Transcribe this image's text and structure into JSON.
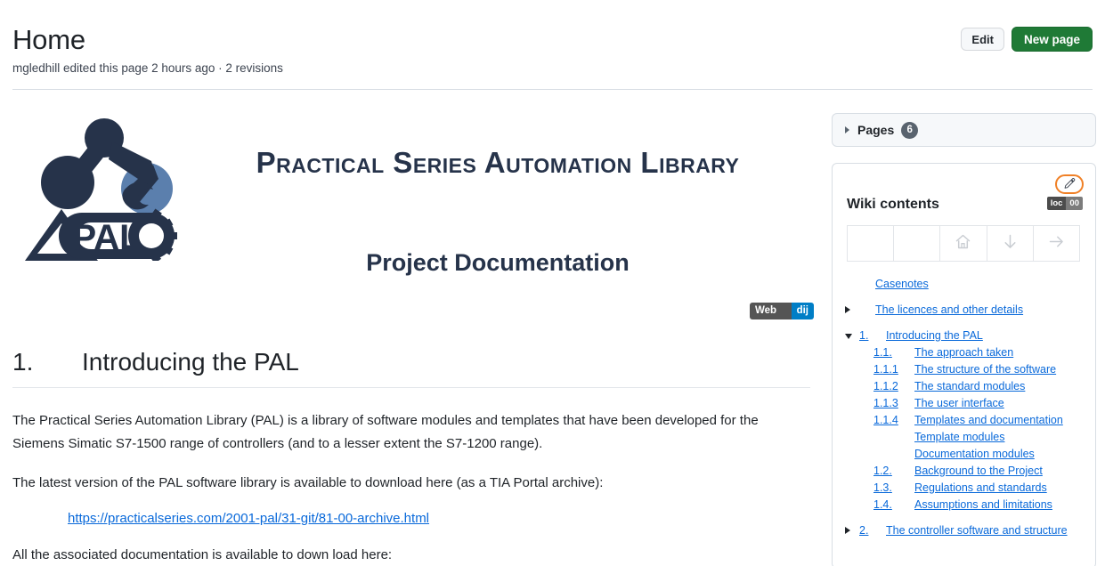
{
  "header": {
    "title": "Home",
    "subtitle": "mgledhill edited this page 2 hours ago · 2 revisions",
    "edit_label": "Edit",
    "new_page_label": "New page"
  },
  "banner": {
    "title": "Practical Series Automation Library",
    "subtitle": "Project Documentation",
    "logo_text": "PAL",
    "logo_colors": {
      "dark": "#26334a",
      "blue": "#5b7fad"
    },
    "webid_badge": {
      "left": "Web ID",
      "right": "dij",
      "left_color": "#555555",
      "right_color": "#007ec6"
    }
  },
  "content": {
    "heading_number": "1.",
    "heading_text": "Introducing the PAL",
    "paragraph_1": "The Practical Series Automation Library (PAL) is a library of software modules and templates that have been developed for the Siemens Simatic S7-1500 range of controllers (and to a lesser extent the S7-1200 range).",
    "paragraph_2": "The latest version of the PAL software library is available to download here (as a TIA Portal archive):",
    "download_link": "https://practicalseries.com/2001-pal/31-git/81-00-archive.html",
    "paragraph_3": "All the associated documentation is available to down load here:"
  },
  "sidebar": {
    "pages": {
      "label": "Pages",
      "count": "6"
    },
    "wiki_contents_title": "Wiki contents",
    "edit_icon": "pencil-icon",
    "loc_badge": {
      "left": "loc",
      "right": "00",
      "left_color": "#4c4c4c",
      "right_color": "#7c7c7c"
    },
    "nav_table": [
      {
        "icon": "",
        "name": "nav-cell-empty-1"
      },
      {
        "icon": "",
        "name": "nav-cell-empty-2"
      },
      {
        "icon": "home-icon",
        "name": "nav-cell-home"
      },
      {
        "icon": "arrow-down-icon",
        "name": "nav-cell-down"
      },
      {
        "icon": "arrow-right-icon",
        "name": "nav-cell-forward"
      }
    ],
    "toc": [
      {
        "caret": "none",
        "num": "",
        "label": "Casenotes",
        "indent": 1,
        "gap": false
      },
      {
        "caret": "right",
        "num": "",
        "label": "The licences and other details",
        "indent": 1,
        "gap": true
      },
      {
        "caret": "down",
        "num": "1.",
        "label": "Introducing the PAL",
        "indent": 0,
        "gap": true
      },
      {
        "caret": "none",
        "num": "1.1.",
        "label": "The approach taken",
        "indent": 2,
        "gap": false
      },
      {
        "caret": "none",
        "num": "1.1.1",
        "label": "The structure of the software",
        "indent": 2,
        "gap": false
      },
      {
        "caret": "none",
        "num": "1.1.2",
        "label": "The standard modules",
        "indent": 2,
        "gap": false
      },
      {
        "caret": "none",
        "num": "1.1.3",
        "label": "The user interface",
        "indent": 2,
        "gap": false
      },
      {
        "caret": "none",
        "num": "1.1.4",
        "label": "Templates and documentation",
        "indent": 2,
        "gap": false
      },
      {
        "caret": "none",
        "num": "",
        "label": "Template modules",
        "indent": 3,
        "gap": false
      },
      {
        "caret": "none",
        "num": "",
        "label": "Documentation modules",
        "indent": 3,
        "gap": false
      },
      {
        "caret": "none",
        "num": "1.2.",
        "label": "Background to the Project",
        "indent": 2,
        "gap": false
      },
      {
        "caret": "none",
        "num": "1.3.",
        "label": "Regulations and standards",
        "indent": 2,
        "gap": false
      },
      {
        "caret": "none",
        "num": "1.4.",
        "label": "Assumptions and limitations",
        "indent": 2,
        "gap": false
      },
      {
        "caret": "right",
        "num": "2.",
        "label": "The controller software and structure",
        "indent": 0,
        "gap": true
      }
    ]
  }
}
